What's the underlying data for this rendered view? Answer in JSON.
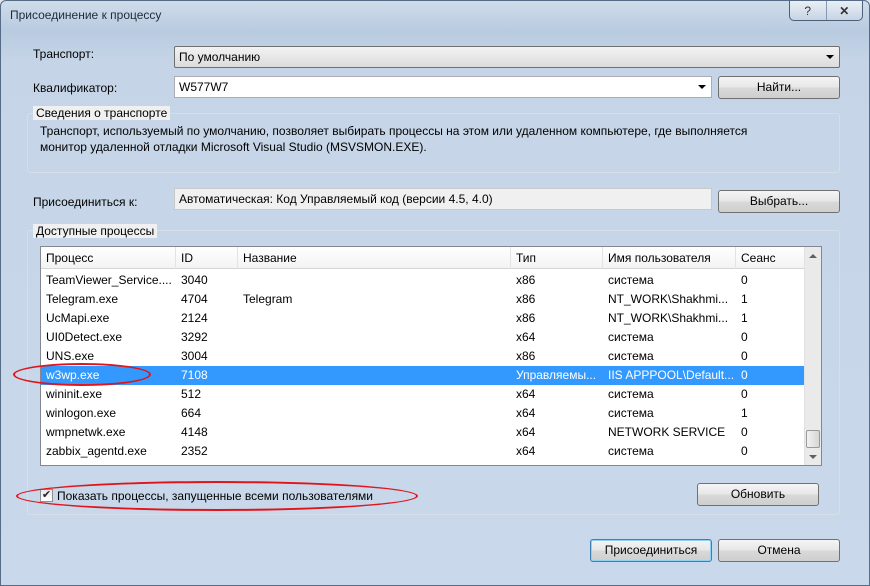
{
  "window": {
    "title": "Присоединение к процессу"
  },
  "transport": {
    "label": "Транспорт:",
    "value": "По умолчанию"
  },
  "qualifier": {
    "label": "Квалификатор:",
    "value": "W577W7",
    "find_button": "Найти..."
  },
  "transport_info": {
    "heading": "Сведения о транспорте",
    "line1": "Транспорт, используемый по умолчанию, позволяет выбирать процессы на этом или удаленном компьютере, где выполняется",
    "line2": "монитор удаленной отладки Microsoft Visual Studio (MSVSMON.EXE)."
  },
  "attach_to": {
    "label": "Присоединиться к:",
    "value": "Автоматическая: Код Управляемый код (версии 4.5, 4.0)",
    "select_button": "Выбрать..."
  },
  "processes": {
    "heading": "Доступные процессы",
    "columns": [
      "Процесс",
      "ID",
      "Название",
      "Тип",
      "Имя пользователя",
      "Сеанс"
    ],
    "rows": [
      {
        "process": "TeamViewer_Service....",
        "id": "3040",
        "title": "",
        "type": "x86",
        "user": "система",
        "session": "0",
        "selected": false
      },
      {
        "process": "Telegram.exe",
        "id": "4704",
        "title": "Telegram",
        "type": "x86",
        "user": "NT_WORK\\Shakhmi...",
        "session": "1",
        "selected": false
      },
      {
        "process": "UcMapi.exe",
        "id": "2124",
        "title": "",
        "type": "x86",
        "user": "NT_WORK\\Shakhmi...",
        "session": "1",
        "selected": false
      },
      {
        "process": "UI0Detect.exe",
        "id": "3292",
        "title": "",
        "type": "x64",
        "user": "система",
        "session": "0",
        "selected": false
      },
      {
        "process": "UNS.exe",
        "id": "3004",
        "title": "",
        "type": "x86",
        "user": "система",
        "session": "0",
        "selected": false
      },
      {
        "process": "w3wp.exe",
        "id": "7108",
        "title": "",
        "type": "Управляемы...",
        "user": "IIS APPPOOL\\Default...",
        "session": "0",
        "selected": true
      },
      {
        "process": "wininit.exe",
        "id": "512",
        "title": "",
        "type": "x64",
        "user": "система",
        "session": "0",
        "selected": false
      },
      {
        "process": "winlogon.exe",
        "id": "664",
        "title": "",
        "type": "x64",
        "user": "система",
        "session": "1",
        "selected": false
      },
      {
        "process": "wmpnetwk.exe",
        "id": "4148",
        "title": "",
        "type": "x64",
        "user": "NETWORK SERVICE",
        "session": "0",
        "selected": false
      },
      {
        "process": "zabbix_agentd.exe",
        "id": "2352",
        "title": "",
        "type": "x64",
        "user": "система",
        "session": "0",
        "selected": false
      }
    ],
    "show_all_users": {
      "label": "Показать процессы, запущенные всеми пользователями",
      "checked": true
    },
    "refresh_button": "Обновить"
  },
  "footer": {
    "attach_button": "Присоединиться",
    "cancel_button": "Отмена"
  },
  "colors": {
    "selection": "#3399ff",
    "highlight_ellipse": "#e0151b"
  }
}
